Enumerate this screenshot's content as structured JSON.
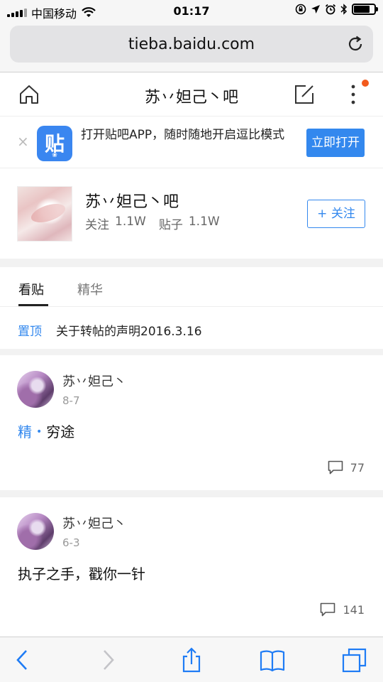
{
  "status_bar": {
    "carrier": "中国移动",
    "time": "01:17",
    "battery_level": 0.8
  },
  "browser": {
    "url": "tieba.baidu.com"
  },
  "header": {
    "title": "苏丷妲己丶吧",
    "has_notification": true
  },
  "banner": {
    "close_symbol": "×",
    "logo_glyph": "贴",
    "message": "打开贴吧APP，随时随地开启逗比模式",
    "open_button": "立即打开"
  },
  "forum": {
    "name": "苏丷妲己丶吧",
    "follow_label": "关注",
    "follow_count": "1.1W",
    "posts_label": "贴子",
    "posts_count": "1.1W",
    "follow_button": "+ 关注"
  },
  "tabs": [
    {
      "label": "看贴",
      "active": true
    },
    {
      "label": "精华",
      "active": false
    }
  ],
  "pinned": {
    "tag": "置顶",
    "title": "关于转帖的声明2016.3.16"
  },
  "posts": [
    {
      "author": "苏丷妲己丶",
      "date": "8-7",
      "tag": "精",
      "title": "穷途",
      "comments": "77"
    },
    {
      "author": "苏丷妲己丶",
      "date": "6-3",
      "tag": "",
      "title": "执子之手，戳你一针",
      "comments": "141"
    }
  ],
  "toolbar": {
    "icons": [
      "back-icon",
      "forward-icon",
      "share-icon",
      "bookmarks-icon",
      "tabs-icon"
    ]
  },
  "colors": {
    "accent": "#3388ee",
    "notification": "#f25a1d"
  }
}
